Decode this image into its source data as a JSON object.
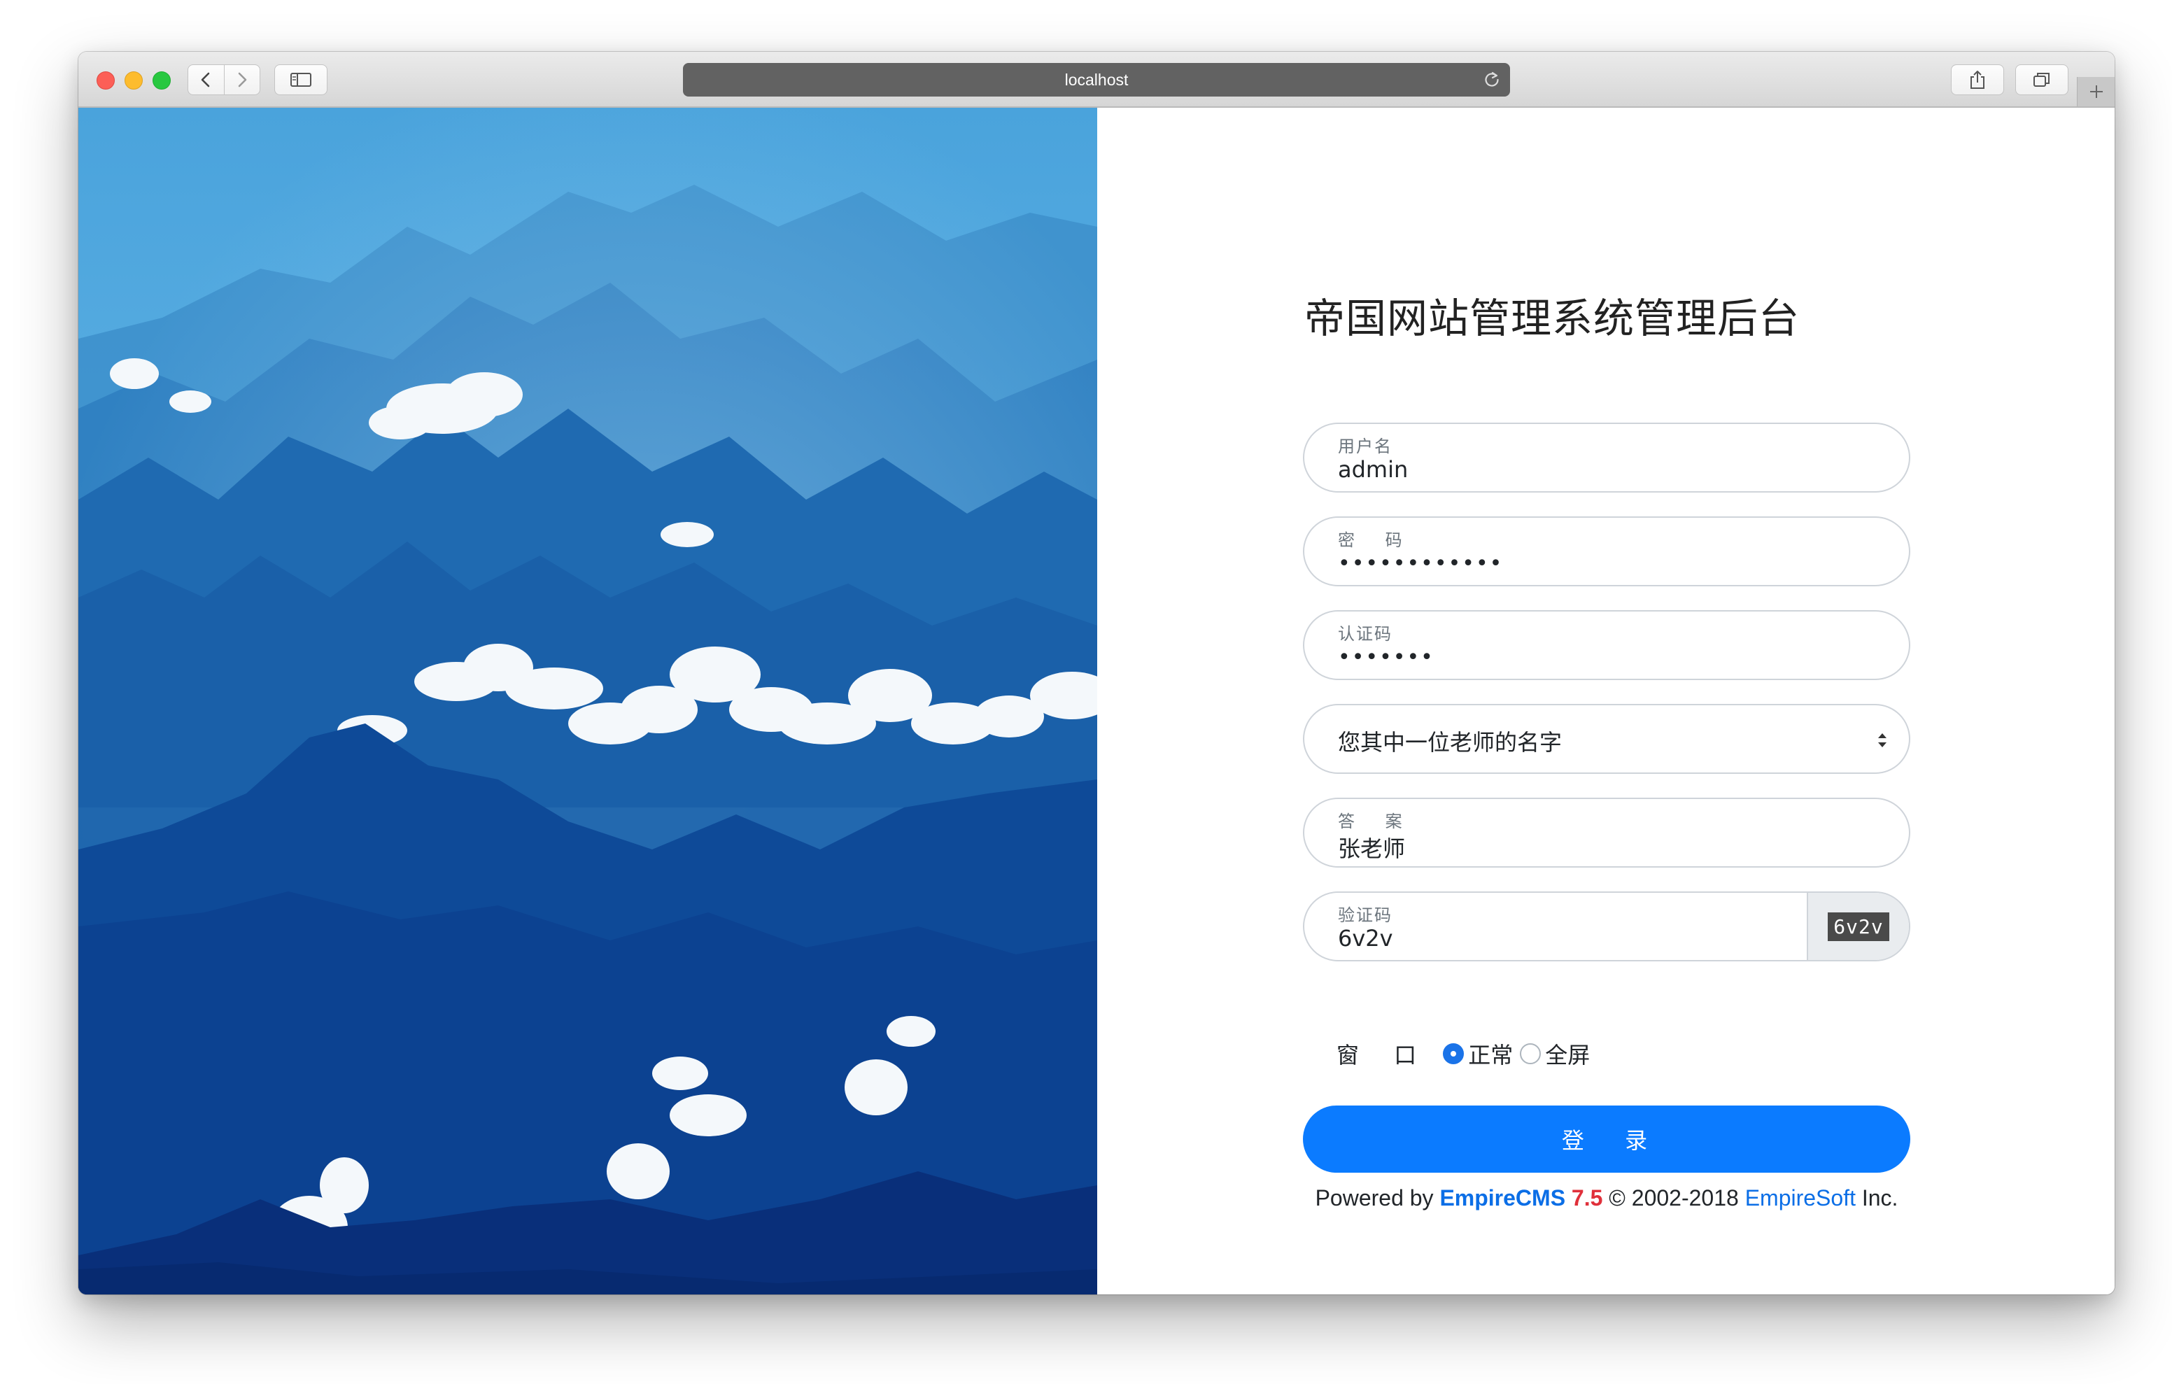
{
  "browser": {
    "address": "localhost",
    "colors": {
      "titlebar": "#dcdcdc",
      "addressbar": "#626262"
    },
    "icons": [
      "back-icon",
      "forward-icon",
      "sidebar-icon",
      "reload-icon",
      "share-icon",
      "tabs-icon",
      "plus-icon"
    ]
  },
  "login": {
    "title": "帝国网站管理系统管理后台",
    "username": {
      "label": "用户名",
      "value": "admin"
    },
    "password": {
      "label": "密 码",
      "masked": "••••••••••••"
    },
    "auth_code": {
      "label": "认证码",
      "masked": "•••••••"
    },
    "question": {
      "selected": "您其中一位老师的名字"
    },
    "answer": {
      "label": "答 案",
      "value": "张老师"
    },
    "verify": {
      "label": "验证码",
      "value": "6v2v",
      "captcha_image_text": "6v2v"
    },
    "window_mode": {
      "label": "窗 口",
      "options": [
        {
          "label": "正常",
          "checked": true
        },
        {
          "label": "全屏",
          "checked": false
        }
      ]
    },
    "submit_label": "登 录",
    "footer": {
      "prefix": "Powered by ",
      "brand": "EmpireCMS",
      "version": "7.5",
      "copyright": " © 2002-2018 ",
      "company": "EmpireSoft",
      "suffix": " Inc."
    },
    "colors": {
      "primary": "#0b7bff",
      "version": "#e0303a",
      "link": "#0b6ee6"
    }
  },
  "hero": {
    "description_icon": "mountain-landscape-image"
  }
}
